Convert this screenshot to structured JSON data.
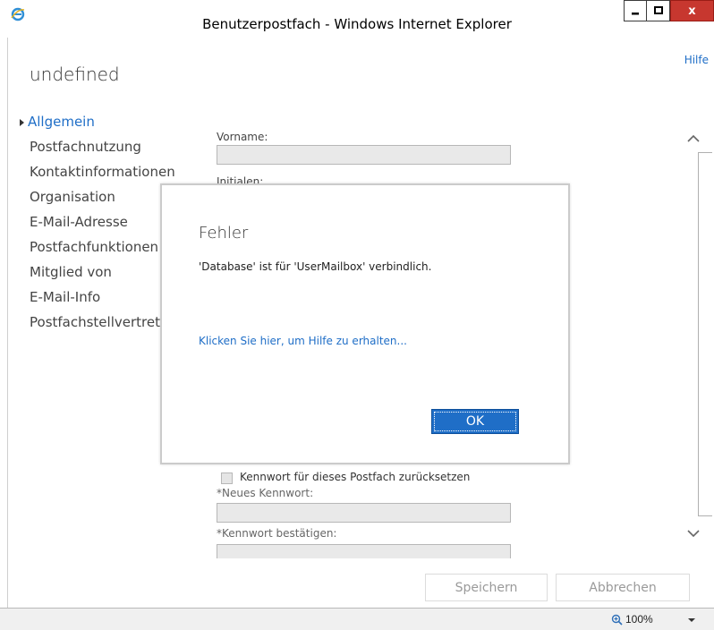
{
  "window": {
    "title": "Benutzerpostfach - Windows Internet Explorer",
    "minimize_label": "‒",
    "maximize_label": "□",
    "close_label": "x",
    "app_icon": "internet-explorer-icon"
  },
  "page": {
    "title": "undefined",
    "help_label": "Hilfe"
  },
  "nav": {
    "items": [
      {
        "label": "Allgemein",
        "active": true
      },
      {
        "label": "Postfachnutzung"
      },
      {
        "label": "Kontaktinformationen"
      },
      {
        "label": "Organisation"
      },
      {
        "label": "E-Mail-Adresse"
      },
      {
        "label": "Postfachfunktionen"
      },
      {
        "label": "Mitglied von"
      },
      {
        "label": "E-Mail-Info"
      },
      {
        "label": "Postfachstellvertretur"
      }
    ]
  },
  "form": {
    "vorname_label": "Vorname:",
    "vorname_value": "",
    "initialen_label": "Initialen:",
    "reset_password_label": "Kennwort für dieses Postfach zurücksetzen",
    "reset_password_checked": false,
    "new_password_label": "*Neues Kennwort:",
    "new_password_value": "",
    "confirm_password_label": "*Kennwort bestätigen:",
    "confirm_password_value": ""
  },
  "footer": {
    "save_label": "Speichern",
    "cancel_label": "Abbrechen"
  },
  "statusbar": {
    "zoom": "100%"
  },
  "dialog": {
    "title": "Fehler",
    "message": "'Database' ist für 'UserMailbox' verbindlich.",
    "help_link": "Klicken Sie hier, um Hilfe zu erhalten...",
    "ok_label": "OK"
  },
  "colors": {
    "accent": "#1f6ec7",
    "close_button": "#c7372f",
    "field_background": "#e9e9e9"
  }
}
